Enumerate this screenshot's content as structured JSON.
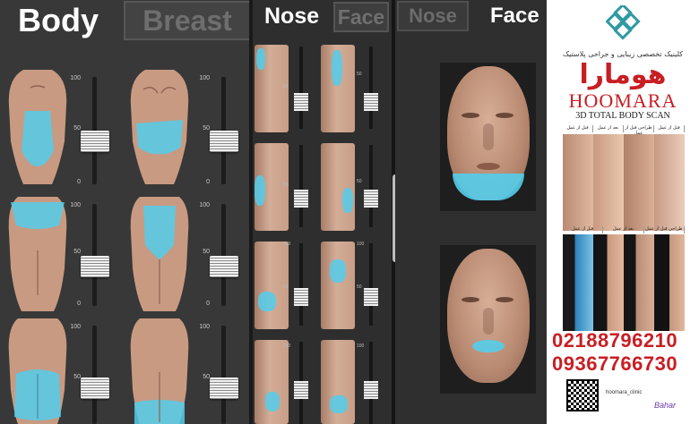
{
  "tabs": {
    "body": "Body",
    "breast": "Breast",
    "nose": "Nose",
    "face": "Face",
    "nose_inactive": "Nose",
    "face_inactive": "Face"
  },
  "body_scale": {
    "top": "100",
    "mid": "50",
    "bottom": "0"
  },
  "nose_scale": {
    "top": "100",
    "mid": "50",
    "bottom": "0"
  },
  "ad": {
    "tagline": "کلینیک تخصصی زیبایی و جراحی پلاستیک",
    "brand_fa": "هومارا",
    "brand_en": "HOOMARA",
    "subtitle": "3D TOTAL BODY SCAN",
    "strip_top": [
      "قبل از عمل",
      "بعد از عمل",
      "طراحی قبل از عمل",
      "قبل از عمل"
    ],
    "strip_bottom": [
      "قبل از عمل",
      "بعد از عمل",
      "طراحی قبل از عمل"
    ],
    "phone1": "02188796210",
    "phone2": "09367766730",
    "instagram": "hoomara_clinic",
    "watermark": "Bahar"
  },
  "colors": {
    "highlight": "#54cdeb",
    "brand_red": "#c81e23",
    "skin": "#c89a82"
  }
}
